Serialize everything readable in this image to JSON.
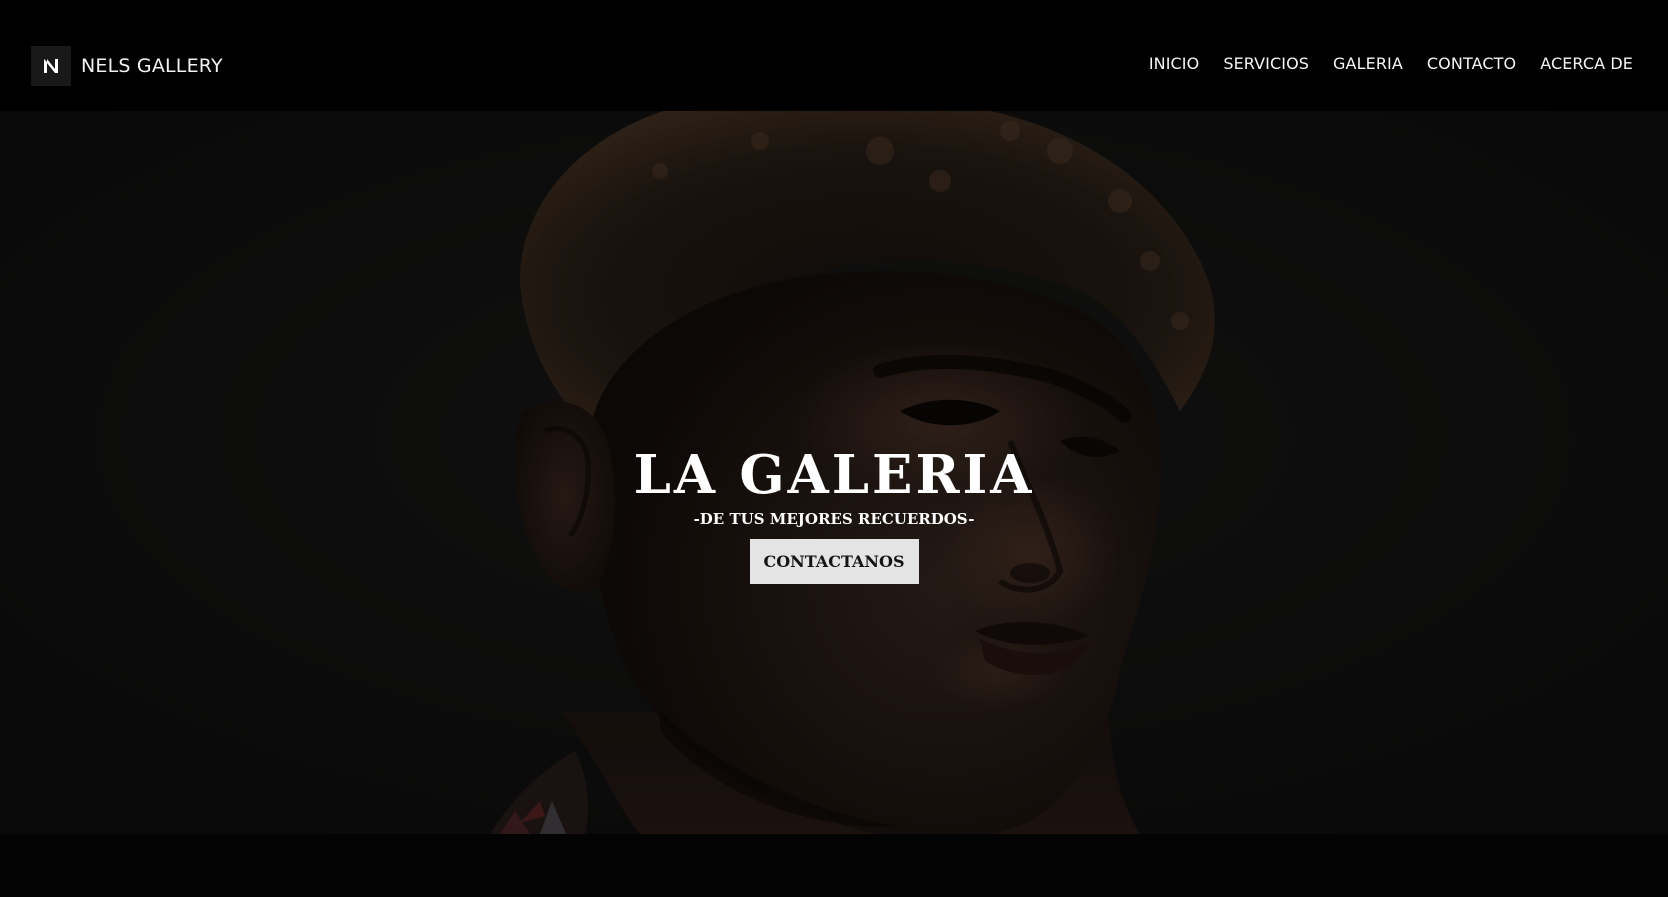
{
  "navbar": {
    "brand_name": "NELS GALLERY",
    "logo_icon": "n-monogram-icon",
    "links": [
      "INICIO",
      "SERVICIOS",
      "GALERIA",
      "CONTACTO",
      "ACERCA DE"
    ]
  },
  "hero": {
    "title": "LA GALERIA",
    "subtitle": "-DE TUS MEJORES RECUERDOS-",
    "button_label": "CONTACTANOS",
    "background_image": "dark portrait photo"
  },
  "colors": {
    "navbar_bg": "#000000",
    "hero_bg": "#121212",
    "button_bg": "#e4e4e4",
    "button_text": "#141414",
    "text": "#ffffff"
  }
}
